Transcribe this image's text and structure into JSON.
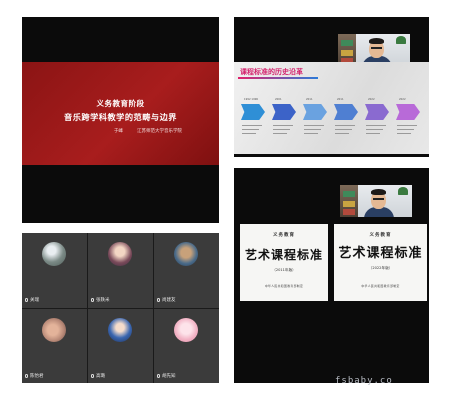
{
  "main_slide": {
    "line1": "义务教育阶段",
    "line2": "音乐跨学科教学的范畴与边界",
    "author": "于峰",
    "org": "江苏师范大学音乐学院"
  },
  "history_slide": {
    "title": "课程标准的历史沿革",
    "timeline": [
      {
        "year": "1992 1996",
        "color": "#2f8fd6"
      },
      {
        "year": "2001",
        "color": "#3c63c8"
      },
      {
        "year": "2011",
        "color": "#6aa2e0"
      },
      {
        "year": "2011",
        "color": "#4f7fd2"
      },
      {
        "year": "2022",
        "color": "#8a6ad0"
      },
      {
        "year": "2022",
        "color": "#b86ad8"
      }
    ]
  },
  "standards": {
    "left": {
      "small": "义务教育",
      "big": "艺术课程标准",
      "edition": "（2011年版）",
      "publisher": "中华人民共和国教育部制定"
    },
    "right": {
      "small": "义务教育",
      "big": "艺术课程标准",
      "edition": "（2022年版）",
      "publisher": "中华人民共和国教育部制定"
    }
  },
  "participants": [
    {
      "name": "关瑞",
      "avatar": "moon-nature-avatar"
    },
    {
      "name": "张轶米",
      "avatar": "cartoon-girl-avatar"
    },
    {
      "name": "尚建友",
      "avatar": "cat-avatar"
    },
    {
      "name": "陈怡君",
      "avatar": "hand-avatar"
    },
    {
      "name": "高璐",
      "avatar": "anime-girl-avatar"
    },
    {
      "name": "胡先知",
      "avatar": "pink-character-avatar"
    }
  ],
  "watermark": "fsbaby.co"
}
